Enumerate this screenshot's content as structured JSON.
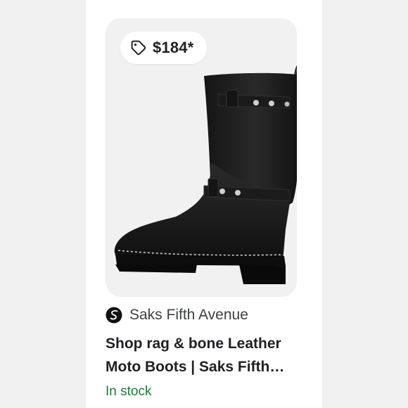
{
  "product": {
    "price": "$184*",
    "price_icon": "price-tag-icon",
    "image_description": "black leather moto boot",
    "merchant": "Saks Fifth Avenue",
    "merchant_icon": "saks-logo-icon",
    "title_line1": "Shop rag & bone Leather",
    "title_line2": "Moto Boots | Saks Fifth…",
    "stock_status": "In stock"
  },
  "colors": {
    "page_background": "#f0f0f0",
    "card_background": "#ffffff",
    "image_background": "#f1f1f1",
    "stock_green": "#188038",
    "text_dark": "#202124",
    "text_gray": "#3c4043"
  }
}
